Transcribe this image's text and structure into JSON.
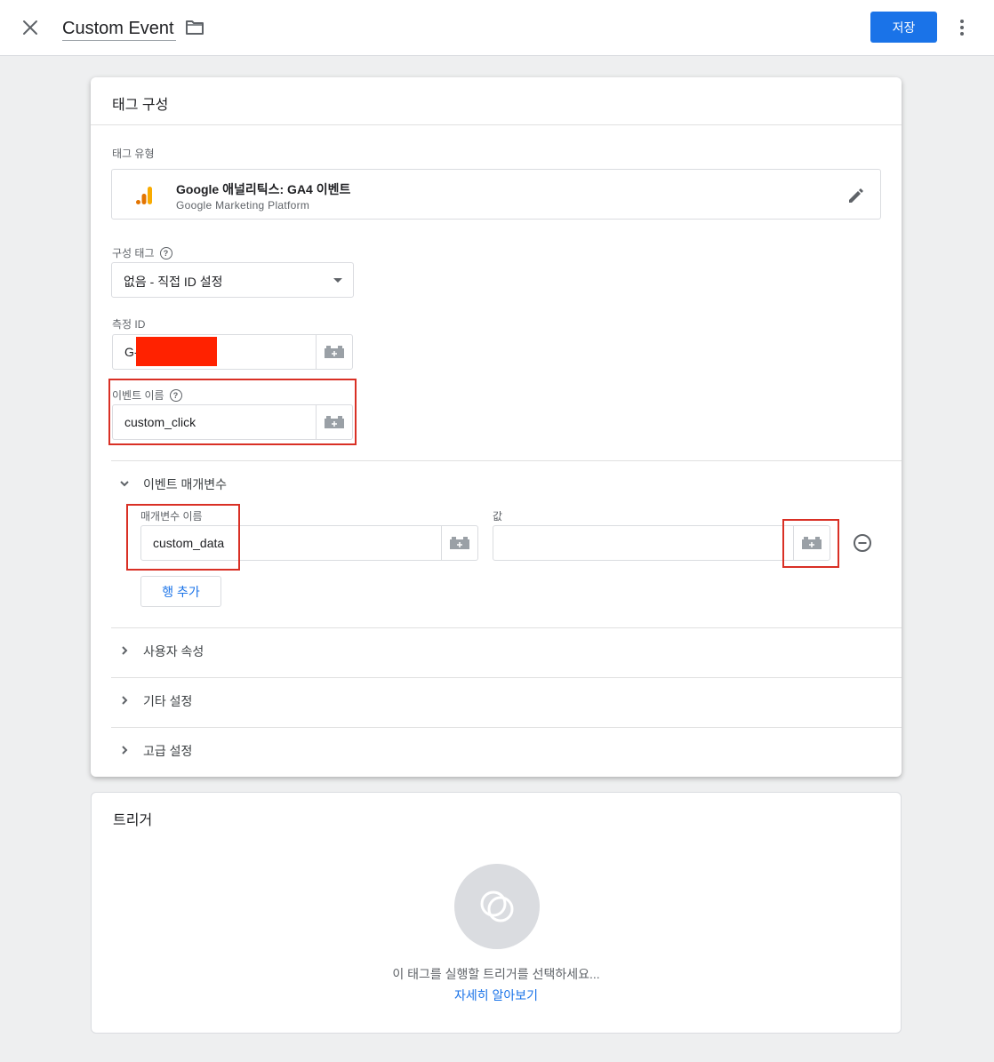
{
  "topbar": {
    "title": "Custom Event",
    "save_label": "저장"
  },
  "config": {
    "header": "태그 구성",
    "tag_type_label": "태그 유형",
    "tag_type_title": "Google 애널리틱스: GA4 이벤트",
    "tag_type_subtitle": "Google Marketing Platform",
    "config_tag_label": "구성 태그",
    "config_tag_value": "없음 - 직접 ID 설정",
    "measurement_id_label": "측정 ID",
    "measurement_id_value": "G-",
    "event_name_label": "이벤트 이름",
    "event_name_value": "custom_click",
    "event_params_label": "이벤트 매개변수",
    "param_name_label": "매개변수 이름",
    "param_value_label": "값",
    "param_name_value": "custom_data",
    "param_value_value": "",
    "add_row_label": "행 추가",
    "sections": [
      "사용자 속성",
      "기타 설정",
      "고급 설정"
    ]
  },
  "trigger": {
    "header": "트리거",
    "message": "이 태그를 실행할 트리거를 선택하세요...",
    "learn_more": "자세히 알아보기"
  },
  "colors": {
    "primary": "#1a73e8",
    "highlight": "#d93025",
    "redaction": "#ff2200",
    "ga_orange": "#f9ab00",
    "ga_dark_orange": "#e37400"
  }
}
